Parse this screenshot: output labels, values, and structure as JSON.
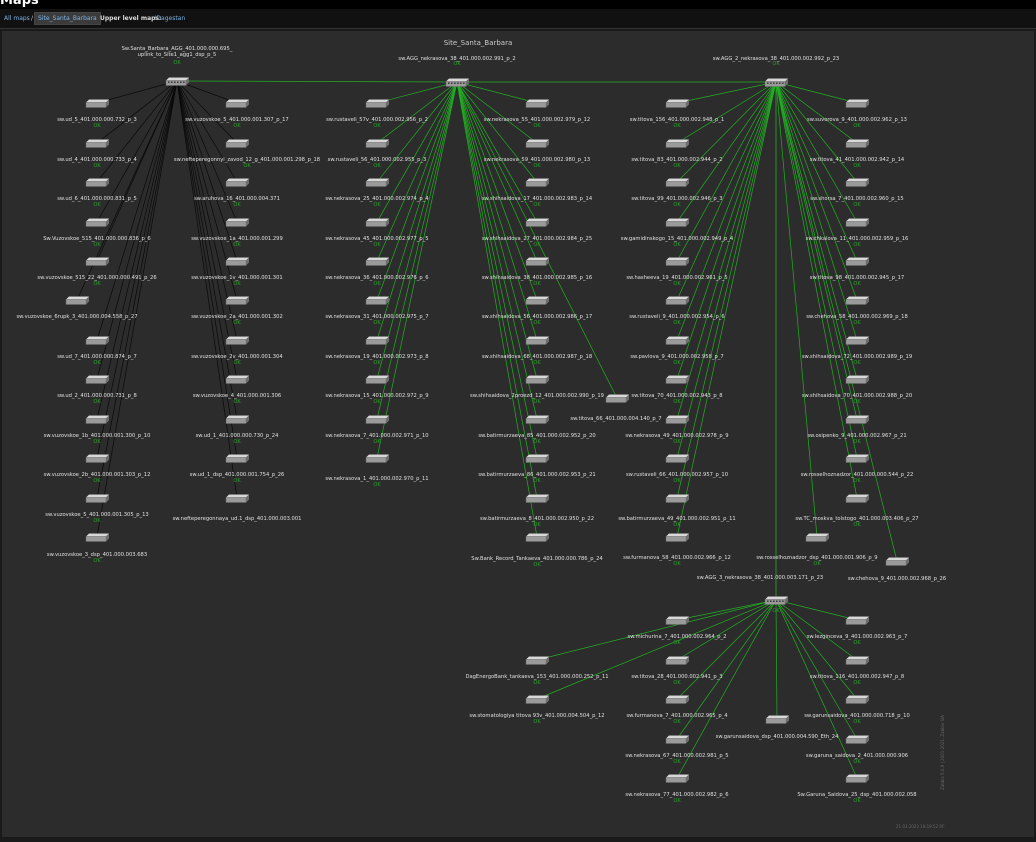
{
  "page": {
    "title": "Maps"
  },
  "breadcrumb": {
    "all_maps": "All maps",
    "sep": "/",
    "current": "Site_Santa_Barbara",
    "upper_label": "Upper level maps:",
    "upper_link": "!Dagestan"
  },
  "map": {
    "title": "Site_Santa_Barbara",
    "timestamp": "21.03.2023 19:19:52 RF",
    "watermark": "Zabbix 5.0.9 | 2001-2021, Zabbix SIA",
    "status_ok": "OK",
    "colors": {
      "background": "#2c2c2c",
      "link_green": "#22b022",
      "link_black": "#0a0a0a",
      "ok": "#2ca02c",
      "label": "#e0e0e0"
    },
    "hubs": [
      {
        "id": "h1",
        "label": "Sw.Santa_Barbara_AGG_401.000.000.695_ uplink_to_Site1_agg1_dsp_p_5",
        "label2": ""
      },
      {
        "id": "h2",
        "label": "sw.AGG_nekrasova_38_401.000.002.991_p_2"
      },
      {
        "id": "h3",
        "label": "sw.AGG_2_nekrasova_38_401.000.002.992_p_23"
      },
      {
        "id": "h4",
        "label": "sw.AGG_3_nekrasova_38_401.000.003.171_p_23"
      }
    ],
    "nodes": [
      {
        "label": "sw.ud_5_401.000.000.732_p_3",
        "ok": true
      },
      {
        "label": "sw.ud_4_401.000.000.733_p_4",
        "ok": true
      },
      {
        "label": "sw.ud_6_401.000.000.831_p_5",
        "ok": true
      },
      {
        "label": "Sw.Vuzovskoe_515_401.000.000.836_p_6",
        "ok": true
      },
      {
        "label": "sw.vuzovskoe_515_22_401.000.000.491_p_26",
        "ok": true
      },
      {
        "label": "sw.vuzovskoe_6rupk_3_401.000.004.558_p_27",
        "ok": false
      },
      {
        "label": "sw.ud_7_401.000.000.874_p_7",
        "ok": true
      },
      {
        "label": "sw.ud_2_401.000.000.731_p_8",
        "ok": true
      },
      {
        "label": "sw.vuzovskoe_1b_401.000.001.300_p_10",
        "ok": true
      },
      {
        "label": "sw.vuzovskoe_2b_401.000.001.303_p_12",
        "ok": true
      },
      {
        "label": "sw.vuzovskoe_5_401.000.001.305_p_13",
        "ok": true
      },
      {
        "label": "sw.vuzovskoe_3_dsp_401.000.003.683",
        "ok": true
      },
      {
        "label": "sw.vuzovskoe_5_401.000.001.307_p_17",
        "ok": true
      },
      {
        "label": "sw.nefteperegonnyi_zavod_12_g_401.000.001.298_p_18",
        "ok": true
      },
      {
        "label": "sw.aruhova_16_401.000.004.371",
        "ok": true
      },
      {
        "label": "sw.vuzovskoe_1a_401.000.001.299",
        "ok": true
      },
      {
        "label": "sw.vuzovskoe_1v_401.000.001.301",
        "ok": true
      },
      {
        "label": "sw.vuzovskoe_2a_401.000.001.302",
        "ok": true
      },
      {
        "label": "sw.vuzovskoe_2v_401.000.001.304",
        "ok": true
      },
      {
        "label": "sw.vuzovskoe_4_401.000.001.306",
        "ok": true
      },
      {
        "label": "sw.ud_1_401.000.000.730_p_24",
        "ok": true
      },
      {
        "label": "sw.ud_1_dsp_401.000.001.754_p_26",
        "ok": true
      },
      {
        "label": "sw.nefteperegonnaya_ud.1_dsp_401.000.003.001",
        "ok": false
      },
      {
        "label": "sw.rustaveli_57v_401.000.002.956_p_2",
        "ok": true
      },
      {
        "label": "sw.rustaveli_56_401.000.002.955_p_3",
        "ok": true
      },
      {
        "label": "sw.nekrasova_25_401.000.002.974_p_4",
        "ok": true
      },
      {
        "label": "sw.nekrasova_45_401.000.002.977_p_5",
        "ok": true
      },
      {
        "label": "sw.nekrasova_36_401.000.002.976_p_6",
        "ok": true
      },
      {
        "label": "sw.nekrasova_31_401.000.002.975_p_7",
        "ok": true
      },
      {
        "label": "sw.nekrasova_19_401.000.002.973_p_8",
        "ok": true
      },
      {
        "label": "sw.nekrasova_15_401.000.002.972_p_9",
        "ok": true
      },
      {
        "label": "sw.nekrasova_7_401.000.002.971_p_10",
        "ok": true
      },
      {
        "label": "sw.nekrasova_1_401.000.002.970_p_11",
        "ok": true
      },
      {
        "label": "sw.nekrasova_55_401.000.002.979_p_12",
        "ok": true
      },
      {
        "label": "sw.nekrasova_59_401.000.002.980_p_13",
        "ok": true
      },
      {
        "label": "sw.shihsaidova_17_401.000.002.983_p_14",
        "ok": true
      },
      {
        "label": "sw.shihsaidova_27_401.000.002.984_p_25",
        "ok": true
      },
      {
        "label": "sw.shihsaidova_38_401.000.002.985_p_16",
        "ok": true
      },
      {
        "label": "sw.shihsaidova_56_401.000.002.986_p_17",
        "ok": true
      },
      {
        "label": "sw.shihsaidova_68_401.000.002.987_p_18",
        "ok": true
      },
      {
        "label": "sw.shihsaidova_2proezd_12_401.000.002.990_p_19",
        "ok": true
      },
      {
        "label": "sw.batirmurzaeva_85_401.000.002.952_p_20",
        "ok": true
      },
      {
        "label": "sw.batirmurzaeva_86_401.000.002.953_p_21",
        "ok": true
      },
      {
        "label": "sw.batirmurzaeva_8_401.000.002.950_p_22",
        "ok": true
      },
      {
        "label": "Sw.Bank_Record_Tankaeva_401.000.000.786_p_24",
        "ok": true
      },
      {
        "label": "sw.titova_66_401.000.004.140_p_7",
        "ok": false
      },
      {
        "label": "sw.titova_156_401.000.002.948_p_1",
        "ok": true
      },
      {
        "label": "sw.titova_83_401.000.002.944_p_2",
        "ok": true
      },
      {
        "label": "sw.titova_99_401.000.002.946_p_3",
        "ok": true
      },
      {
        "label": "sw.gamidinskogo_15_401.000.002.949_p_4",
        "ok": true
      },
      {
        "label": "sw.hasheeva_19_401.000.002.961_p_5",
        "ok": true
      },
      {
        "label": "sw.rustaveli_9_401.000.002.954_p_6",
        "ok": true
      },
      {
        "label": "sw.pavlova_9_401.000.002.958_p_7",
        "ok": true
      },
      {
        "label": "sw.titova_70_401.000.002.943_p_8",
        "ok": true
      },
      {
        "label": "sw.nekrasova_49_401.000.002.978_p_9",
        "ok": true
      },
      {
        "label": "sw.rustaveli_66_401.000.002.957_p_10",
        "ok": true
      },
      {
        "label": "sw.batirmurzaeva_49_401.000.002.951_p_11",
        "ok": true
      },
      {
        "label": "sw.furmanova_58_401.000.002.966_p_12",
        "ok": true
      },
      {
        "label": "sw.suvorova_9_401.000.002.962_p_13",
        "ok": true
      },
      {
        "label": "sw.titova_41_401.000.002.942_p_14",
        "ok": true
      },
      {
        "label": "sw.shorsa_7_401.000.002.960_p_15",
        "ok": true
      },
      {
        "label": "sw.chkalova_11_401.000.002.959_p_16",
        "ok": true
      },
      {
        "label": "sw.titova_98_401.000.002.945_p_17",
        "ok": true
      },
      {
        "label": "sw.chehova_58_401.000.002.969_p_18",
        "ok": true
      },
      {
        "label": "sw.shihsaidova_72_401.000.002.989_p_19",
        "ok": true
      },
      {
        "label": "sw.shihsaidova_70_401.000.002.988_p_20",
        "ok": true
      },
      {
        "label": "sw.osipenko_9_401.000.002.967_p_21",
        "ok": true
      },
      {
        "label": "sw.rosselhoznadzor_401.000.000.544_p_22",
        "ok": true
      },
      {
        "label": "sw.TC_moskva_tolstogo_401.000.003.406_p_27",
        "ok": true
      },
      {
        "label": "sw.rosselhoznadzor_dsp_401.000.001.906_p_9",
        "ok": true
      },
      {
        "label": "sw.chehova_9_401.000.002.968_p_26",
        "ok": false
      },
      {
        "label": "sw.michurina_7_401.000.002.964_p_2",
        "ok": true
      },
      {
        "label": "DagEnergoBank_tankaeva_153_401.000.000.252_p_11",
        "ok": true
      },
      {
        "label": "sw.titova_28_401.000.002.941_p_3",
        "ok": true
      },
      {
        "label": "sw.stomatologiya titova 93v_401.000.004.504_p_12",
        "ok": true
      },
      {
        "label": "sw.furmanova_7_401.000.002.965_p_4",
        "ok": true
      },
      {
        "label": "sw.nekrasova_67_401.000.002.981_p_5",
        "ok": true
      },
      {
        "label": "sw.nekrasova_77_401.000.002.982_p_6",
        "ok": true
      },
      {
        "label": "sw.lezginceva_9_401.000.002.963_p_7",
        "ok": true
      },
      {
        "label": "sw.titova_116_401.000.002.947_p_8",
        "ok": true
      },
      {
        "label": "sw.garunsaidova_401.000.000.718_p_10",
        "ok": true
      },
      {
        "label": "sw.garunsaidova_dsp_401.000.004.590_Eth_24",
        "ok": false
      },
      {
        "label": "sw.garuna_saidova_2_401.000.000.906",
        "ok": true
      },
      {
        "label": "Sw.Garuna_Saidova_25_dsp_401.000.002.058",
        "ok": true
      }
    ]
  }
}
